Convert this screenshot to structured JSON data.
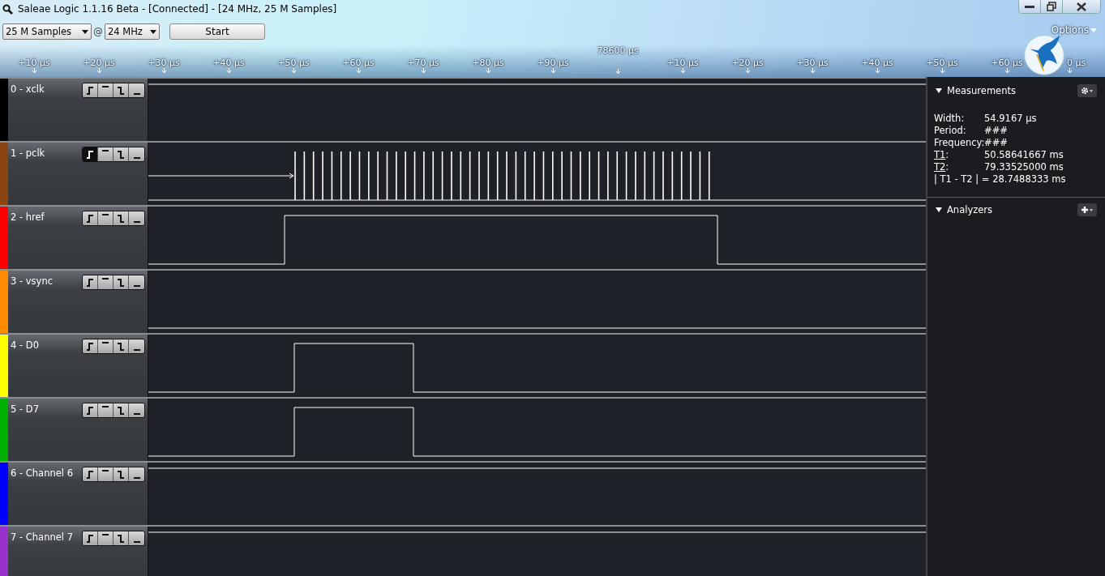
{
  "window": {
    "title": "Saleae Logic 1.1.16 Beta - [Connected] - [24 MHz, 25 M Samples]"
  },
  "toolbar": {
    "samples": "25 M Samples",
    "at": "@",
    "rate": "24 MHz",
    "start": "Start",
    "options": "Options"
  },
  "ruler": {
    "center": "78600 µs",
    "ticks": [
      "+10 µs",
      "+20 µs",
      "+30 µs",
      "+40 µs",
      "+50 µs",
      "+60 µs",
      "+70 µs",
      "+80 µs",
      "+90 µs",
      "+10 µs",
      "+20 µs",
      "+30 µs",
      "+40 µs",
      "+50 µs",
      "+60 µs",
      "0 µs"
    ]
  },
  "channels": [
    {
      "name": "0 - xclk",
      "color": "#000000",
      "kind": "high",
      "triggers": [
        {
          "kind": "rising",
          "selected": false
        },
        {
          "kind": "high",
          "selected": false
        },
        {
          "kind": "falling",
          "selected": false
        },
        {
          "kind": "low",
          "selected": false
        }
      ]
    },
    {
      "name": "1 - pclk",
      "color": "#8b4513",
      "kind": "clock",
      "triggers": [
        {
          "kind": "rising",
          "selected": true
        },
        {
          "kind": "high",
          "selected": false
        },
        {
          "kind": "falling",
          "selected": false
        },
        {
          "kind": "low",
          "selected": false
        }
      ]
    },
    {
      "name": "2 - href",
      "color": "#ff0000",
      "kind": "gate",
      "triggers": [
        {
          "kind": "rising",
          "selected": false
        },
        {
          "kind": "high",
          "selected": false
        },
        {
          "kind": "falling",
          "selected": false
        },
        {
          "kind": "low",
          "selected": false
        }
      ]
    },
    {
      "name": "3 - vsync",
      "color": "#ff8c00",
      "kind": "low",
      "triggers": [
        {
          "kind": "rising",
          "selected": false
        },
        {
          "kind": "high",
          "selected": false
        },
        {
          "kind": "falling",
          "selected": false
        },
        {
          "kind": "low",
          "selected": false
        }
      ]
    },
    {
      "name": "4 - D0",
      "color": "#ffff00",
      "kind": "pulse",
      "triggers": [
        {
          "kind": "rising",
          "selected": false
        },
        {
          "kind": "high",
          "selected": false
        },
        {
          "kind": "falling",
          "selected": false
        },
        {
          "kind": "low",
          "selected": false
        }
      ]
    },
    {
      "name": "5 - D7",
      "color": "#00b000",
      "kind": "pulse",
      "triggers": [
        {
          "kind": "rising",
          "selected": false
        },
        {
          "kind": "high",
          "selected": false
        },
        {
          "kind": "falling",
          "selected": false
        },
        {
          "kind": "low",
          "selected": false
        }
      ]
    },
    {
      "name": "6 - Channel 6",
      "color": "#0000ff",
      "kind": "high",
      "triggers": [
        {
          "kind": "rising",
          "selected": false
        },
        {
          "kind": "high",
          "selected": false
        },
        {
          "kind": "falling",
          "selected": false
        },
        {
          "kind": "low",
          "selected": false
        }
      ]
    },
    {
      "name": "7 - Channel 7",
      "color": "#9932cc",
      "kind": "high",
      "triggers": [
        {
          "kind": "rising",
          "selected": false
        },
        {
          "kind": "high",
          "selected": false
        },
        {
          "kind": "falling",
          "selected": false
        },
        {
          "kind": "low",
          "selected": false
        }
      ]
    }
  ],
  "measurements": {
    "title": "Measurements",
    "expanded": true,
    "rows": [
      {
        "label": "Width:",
        "value": "54.9167 µs",
        "link": false
      },
      {
        "label": "Period:",
        "value": "###",
        "link": false
      },
      {
        "label": "Frequency:",
        "value": "###",
        "link": false
      },
      {
        "label": "T1",
        "suffix": ":",
        "value": "50.58641667 ms",
        "link": true
      },
      {
        "label": "T2",
        "suffix": ":",
        "value": "79.33525000 ms",
        "link": true
      }
    ],
    "difference": "| T1 - T2 | = 28.7488333 ms"
  },
  "analyzers": {
    "title": "Analyzers",
    "expanded": true
  }
}
